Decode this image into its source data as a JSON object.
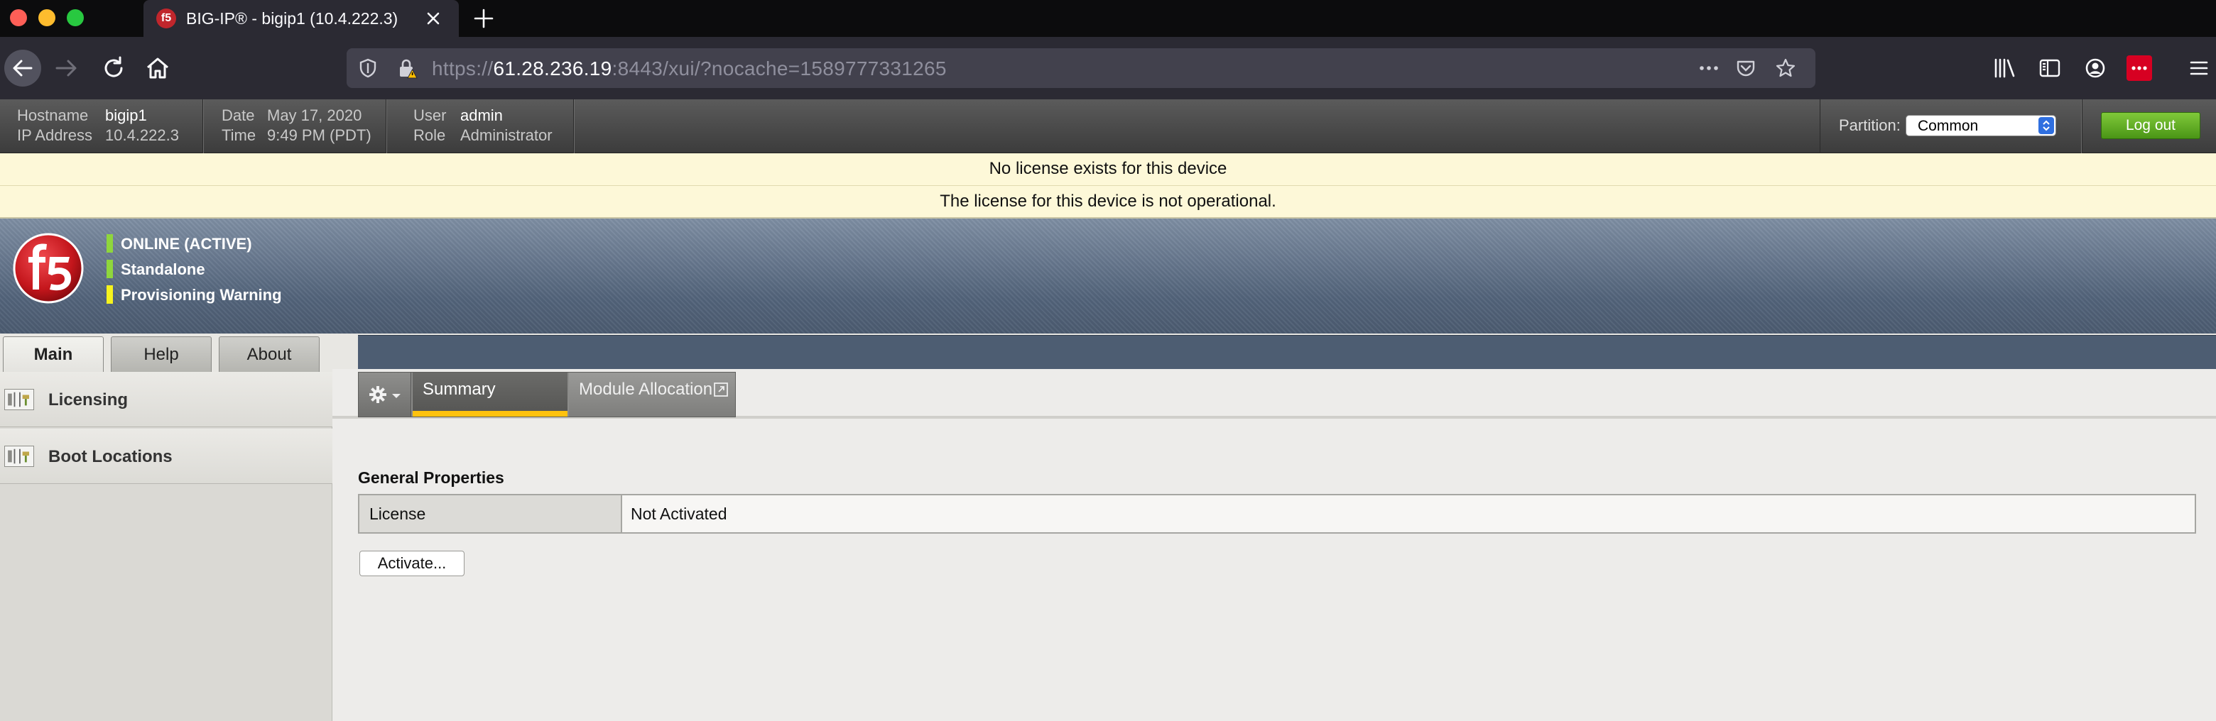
{
  "browser": {
    "tab_title": "BIG-IP® - bigip1 (10.4.222.3)",
    "favicon_text": "f5",
    "url_prefix": "https://",
    "url_host": "61.28.236.19",
    "url_rest": ":8443/xui/?nocache=1589777331265"
  },
  "header": {
    "hostname_label": "Hostname",
    "hostname": "bigip1",
    "ip_label": "IP Address",
    "ip": "10.4.222.3",
    "date_label": "Date",
    "date": "May 17, 2020",
    "time_label": "Time",
    "time": "9:49 PM (PDT)",
    "user_label": "User",
    "user": "admin",
    "role_label": "Role",
    "role": "Administrator",
    "partition_label": "Partition:",
    "partition_value": "Common",
    "logout_label": "Log out"
  },
  "banners": [
    "No license exists for this device",
    "The license for this device is not operational."
  ],
  "status": {
    "items": [
      {
        "label": "ONLINE (ACTIVE)",
        "color": "#8fd63c"
      },
      {
        "label": "Standalone",
        "color": "#8fd63c"
      },
      {
        "label": "Provisioning Warning",
        "color": "#f6f31d"
      }
    ]
  },
  "tabs": {
    "main": "Main",
    "help": "Help",
    "about": "About"
  },
  "sidebar": {
    "items": [
      {
        "label": "Licensing",
        "icon": "licensing-icon"
      },
      {
        "label": "Boot Locations",
        "icon": "boot-locations-icon"
      }
    ]
  },
  "subtabs": {
    "summary": "Summary",
    "module_allocation": "Module Allocation"
  },
  "general_properties": {
    "title": "General Properties",
    "rows": [
      {
        "label": "License",
        "value": "Not Activated"
      }
    ]
  },
  "actions": {
    "activate": "Activate..."
  },
  "colors": {
    "accent_yellow": "#ffc20e",
    "logout_green": "#5aa81f",
    "banner_bg": "#fdf8d8"
  }
}
